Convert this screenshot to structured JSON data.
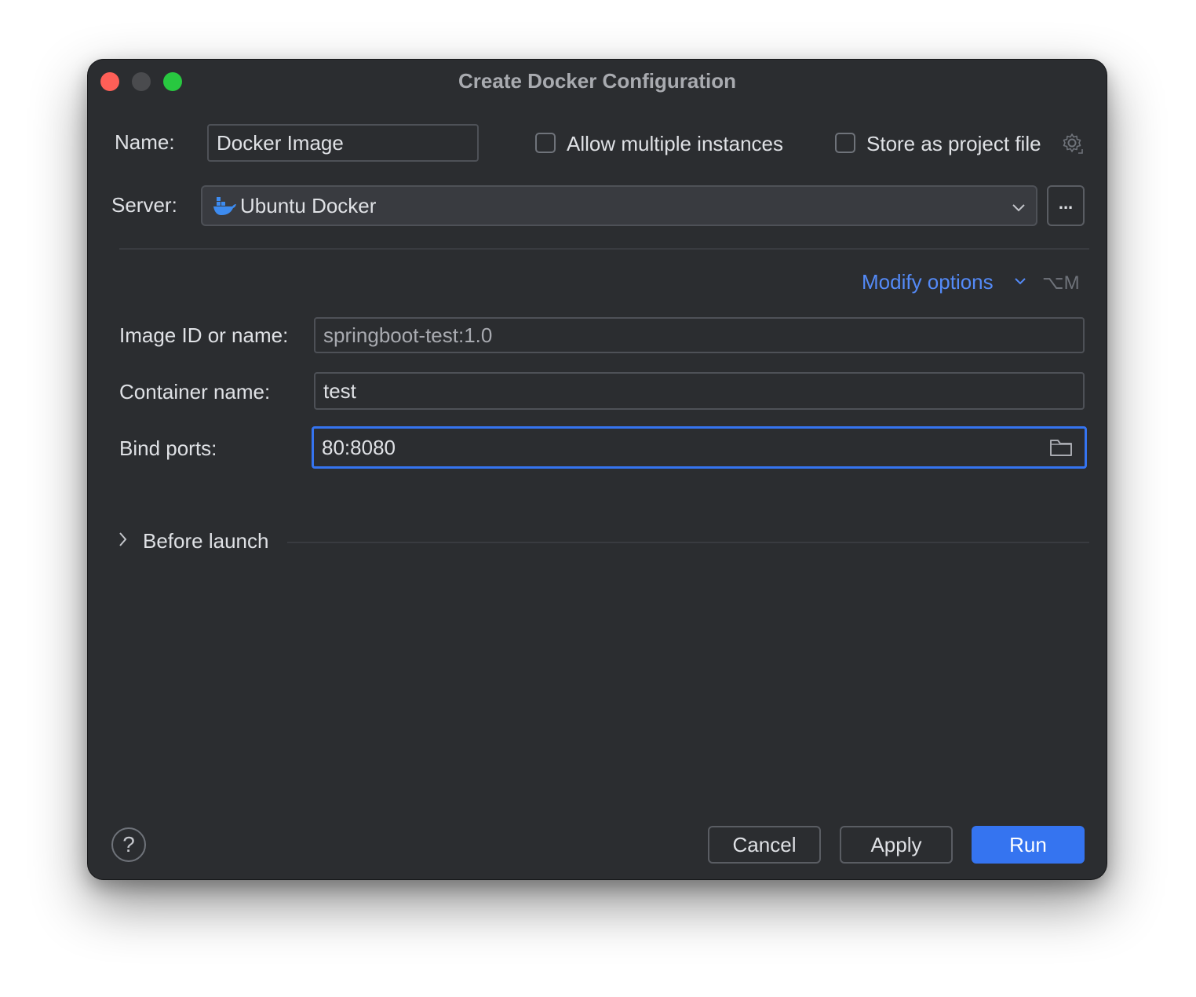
{
  "window": {
    "title": "Create Docker Configuration"
  },
  "form": {
    "name_label": "Name:",
    "name_value": "Docker Image",
    "allow_multiple_label": "Allow multiple instances",
    "store_project_label": "Store as project file",
    "server_label": "Server:",
    "server_value": "Ubuntu Docker",
    "server_more_label": "...",
    "modify_options_label": "Modify options",
    "modify_options_shortcut": "⌥M",
    "image_label": "Image ID or name:",
    "image_value": "springboot-test:1.0",
    "container_label": "Container name:",
    "container_value": "test",
    "ports_label": "Bind ports:",
    "ports_value": "80:8080",
    "before_launch_label": "Before launch"
  },
  "footer": {
    "help_label": "?",
    "cancel_label": "Cancel",
    "apply_label": "Apply",
    "run_label": "Run"
  },
  "colors": {
    "background": "#2b2d30",
    "accent": "#3574f0",
    "link": "#548af7",
    "docker_icon": "#3d8bf0"
  },
  "icons": [
    "gear-icon",
    "docker-icon",
    "chevron-down-icon",
    "folder-icon",
    "chevron-right-icon",
    "help-icon"
  ]
}
